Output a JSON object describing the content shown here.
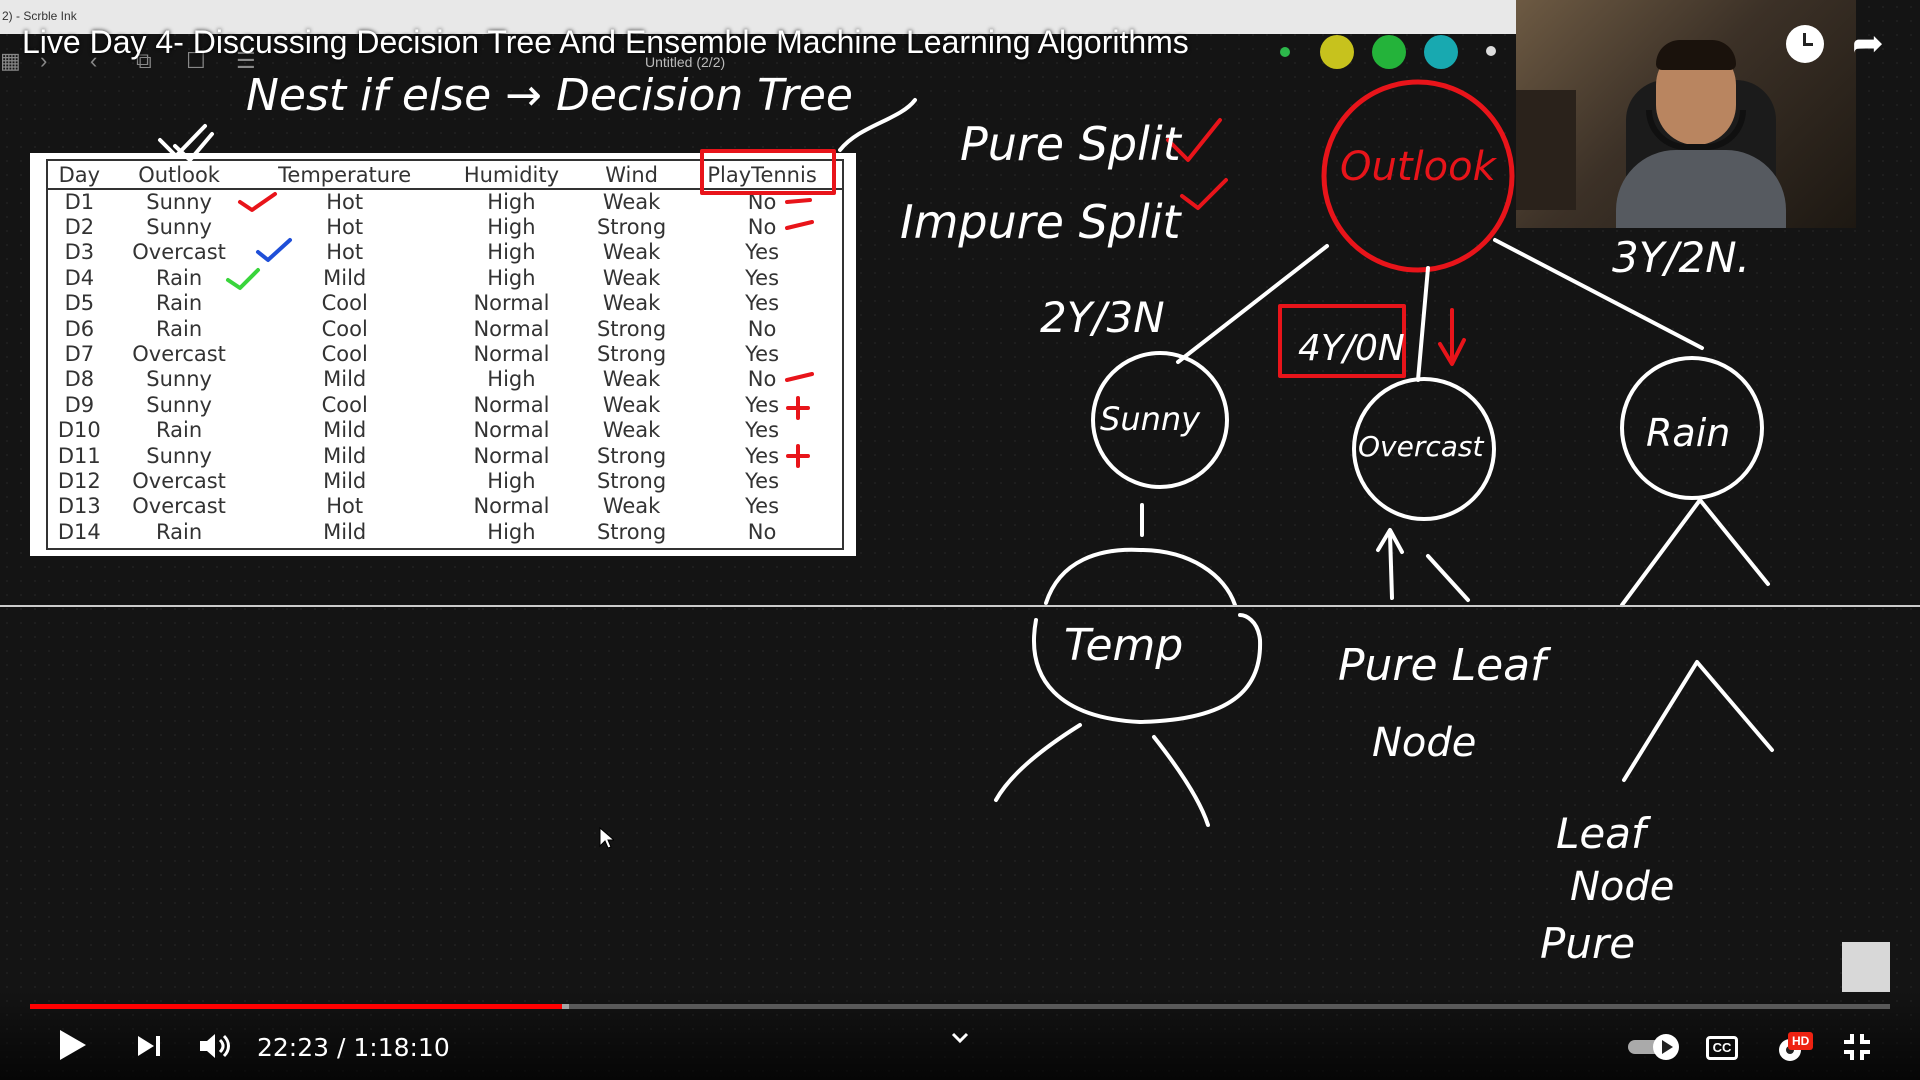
{
  "window": {
    "app_title": "2) - Scrble Ink",
    "document_label": "Untitled (2/2)"
  },
  "video": {
    "title": "Live Day 4- Discussing Decision Tree And Ensemble Machine Learning Algorithms",
    "current_time": "22:23",
    "duration": "1:18:10",
    "time_display": "22:23 / 1:18:10",
    "played_fraction": 0.286,
    "buffered_fraction": 0.29
  },
  "palette": {
    "colors": [
      "#2db84b",
      "#c7c21d",
      "#24b33a",
      "#18a9b0",
      "#ffffff"
    ],
    "ink_white": "#ffffff",
    "ink_red": "#e8141a",
    "ink_blue": "#1f4fd8",
    "ink_green": "#39d53b",
    "progress_red": "#ff0000"
  },
  "table": {
    "headers": [
      "Day",
      "Outlook",
      "Temperature",
      "Humidity",
      "Wind",
      "PlayTennis"
    ],
    "rows": [
      [
        "D1",
        "Sunny",
        "Hot",
        "High",
        "Weak",
        "No"
      ],
      [
        "D2",
        "Sunny",
        "Hot",
        "High",
        "Strong",
        "No"
      ],
      [
        "D3",
        "Overcast",
        "Hot",
        "High",
        "Weak",
        "Yes"
      ],
      [
        "D4",
        "Rain",
        "Mild",
        "High",
        "Weak",
        "Yes"
      ],
      [
        "D5",
        "Rain",
        "Cool",
        "Normal",
        "Weak",
        "Yes"
      ],
      [
        "D6",
        "Rain",
        "Cool",
        "Normal",
        "Strong",
        "No"
      ],
      [
        "D7",
        "Overcast",
        "Cool",
        "Normal",
        "Strong",
        "Yes"
      ],
      [
        "D8",
        "Sunny",
        "Mild",
        "High",
        "Weak",
        "No"
      ],
      [
        "D9",
        "Sunny",
        "Cool",
        "Normal",
        "Weak",
        "Yes"
      ],
      [
        "D10",
        "Rain",
        "Mild",
        "Normal",
        "Weak",
        "Yes"
      ],
      [
        "D11",
        "Sunny",
        "Mild",
        "Normal",
        "Strong",
        "Yes"
      ],
      [
        "D12",
        "Overcast",
        "Mild",
        "High",
        "Strong",
        "Yes"
      ],
      [
        "D13",
        "Overcast",
        "Hot",
        "Normal",
        "Weak",
        "Yes"
      ],
      [
        "D14",
        "Rain",
        "Mild",
        "High",
        "Strong",
        "No"
      ]
    ]
  },
  "handwriting": {
    "top_note": "Nest if else → Decision Tree",
    "pure_split": "Pure Split",
    "impure_split": "Impure Split",
    "root_node": "Outlook",
    "sunny_count": "2Y/3N",
    "overcast_count": "4Y/0N",
    "rain_count": "3Y/2N.",
    "node_sunny": "Sunny",
    "node_overcast": "Overcast",
    "node_rain": "Rain",
    "node_temp": "Temp",
    "pure_leaf_1": "Pure Leaf",
    "pure_leaf_2": "Node",
    "leaf_node_1": "Leaf",
    "leaf_node_2": "Node",
    "leaf_node_3": "Pure"
  },
  "icons": {
    "toolbar": [
      "grid-icon",
      "redo-icon",
      "undo-icon",
      "copy-icon",
      "page-icon",
      "sliders-icon"
    ],
    "controls": [
      "play-icon",
      "next-icon",
      "volume-icon",
      "chevron-down-icon",
      "autoplay-toggle-icon",
      "captions-icon",
      "settings-icon",
      "fullscreen-exit-icon"
    ],
    "header": [
      "watch-later-icon",
      "share-icon"
    ]
  },
  "badges": {
    "hd": "HD",
    "cc": "CC"
  }
}
